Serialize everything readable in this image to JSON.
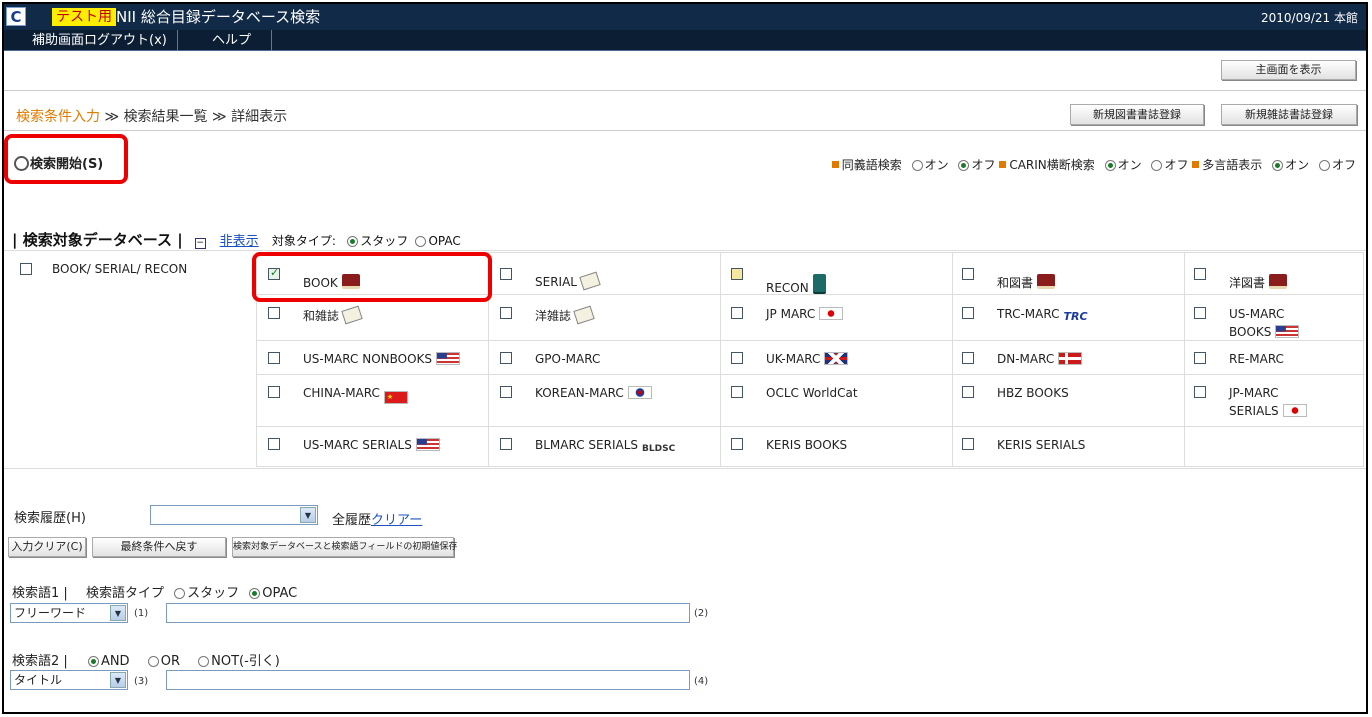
{
  "titlebar": {
    "logo": "C",
    "badge": "テスト用",
    "title": "NII 総合目録データベース検索",
    "date": "2010/09/21 本館"
  },
  "menu": {
    "logout": "補助画面ログアウト(x)",
    "help": "ヘルプ"
  },
  "main_button": "主画面を表示",
  "breadcrumb": {
    "step1": "検索条件入力",
    "sep": " ≫ ",
    "step2": "検索結果一覧",
    "step3": "詳細表示"
  },
  "top_buttons": {
    "new_book": "新規図書書誌登録",
    "new_serial": "新規雑誌書誌登録"
  },
  "search_start": "検索開始(S)",
  "options": {
    "synonym": "同義語検索",
    "carin": "CARIN横断検索",
    "multilang": "多言語表示",
    "on": "オン",
    "off": "オフ"
  },
  "db_section": {
    "title": "検索対象データベース",
    "hide": "非表示",
    "target_type": "対象タイプ:",
    "staff": "スタッフ",
    "opac": "OPAC"
  },
  "db_group": "BOOK/ SERIAL/ RECON",
  "databases": [
    {
      "label": "BOOK",
      "checked": true
    },
    {
      "label": "SERIAL",
      "checked": false
    },
    {
      "label": "RECON",
      "checked": "partial"
    },
    {
      "label": "和図書",
      "checked": false
    },
    {
      "label": "洋図書",
      "checked": false
    },
    {
      "label": "和雑誌",
      "checked": false
    },
    {
      "label": "洋雑誌",
      "checked": false
    },
    {
      "label": "JP MARC",
      "checked": false
    },
    {
      "label": "TRC-MARC",
      "checked": false,
      "logo": "TRC"
    },
    {
      "label": "US-MARC",
      "label2": "BOOKS",
      "checked": false
    },
    {
      "label": "US-MARC NONBOOKS",
      "checked": false
    },
    {
      "label": "GPO-MARC",
      "checked": false
    },
    {
      "label": "UK-MARC",
      "checked": false
    },
    {
      "label": "DN-MARC",
      "checked": false
    },
    {
      "label": "RE-MARC",
      "checked": false
    },
    {
      "label": "CHINA-MARC",
      "checked": false
    },
    {
      "label": "KOREAN-MARC",
      "checked": false
    },
    {
      "label": "OCLC WorldCat",
      "checked": false
    },
    {
      "label": "HBZ BOOKS",
      "checked": false
    },
    {
      "label": "JP-MARC",
      "label2": "SERIALS",
      "checked": false
    },
    {
      "label": "US-MARC SERIALS",
      "checked": false
    },
    {
      "label": "BLMARC SERIALS",
      "checked": false,
      "logo": "BLDSC"
    },
    {
      "label": "KERIS BOOKS",
      "checked": false
    },
    {
      "label": "KERIS SERIALS",
      "checked": false
    }
  ],
  "history": {
    "label": "検索履歴(H)",
    "clear_prefix": "全履歴",
    "clear_link": "クリアー"
  },
  "action_buttons": {
    "clear_input": "入力クリア(C)",
    "last_condition": "最終条件へ戻す",
    "save_default": "検索対象データベースと検索語フィールドの初期値保存"
  },
  "keyword1": {
    "label": "検索語1 |",
    "type_label": "検索語タイプ",
    "staff": "スタッフ",
    "opac": "OPAC",
    "field": "フリーワード",
    "n1": "(1)",
    "n2": "(2)"
  },
  "keyword2": {
    "label": "検索語2 |",
    "and": "AND",
    "or": "OR",
    "not": "NOT(-引く)",
    "field": "タイトル",
    "n3": "(3)",
    "n4": "(4)"
  }
}
